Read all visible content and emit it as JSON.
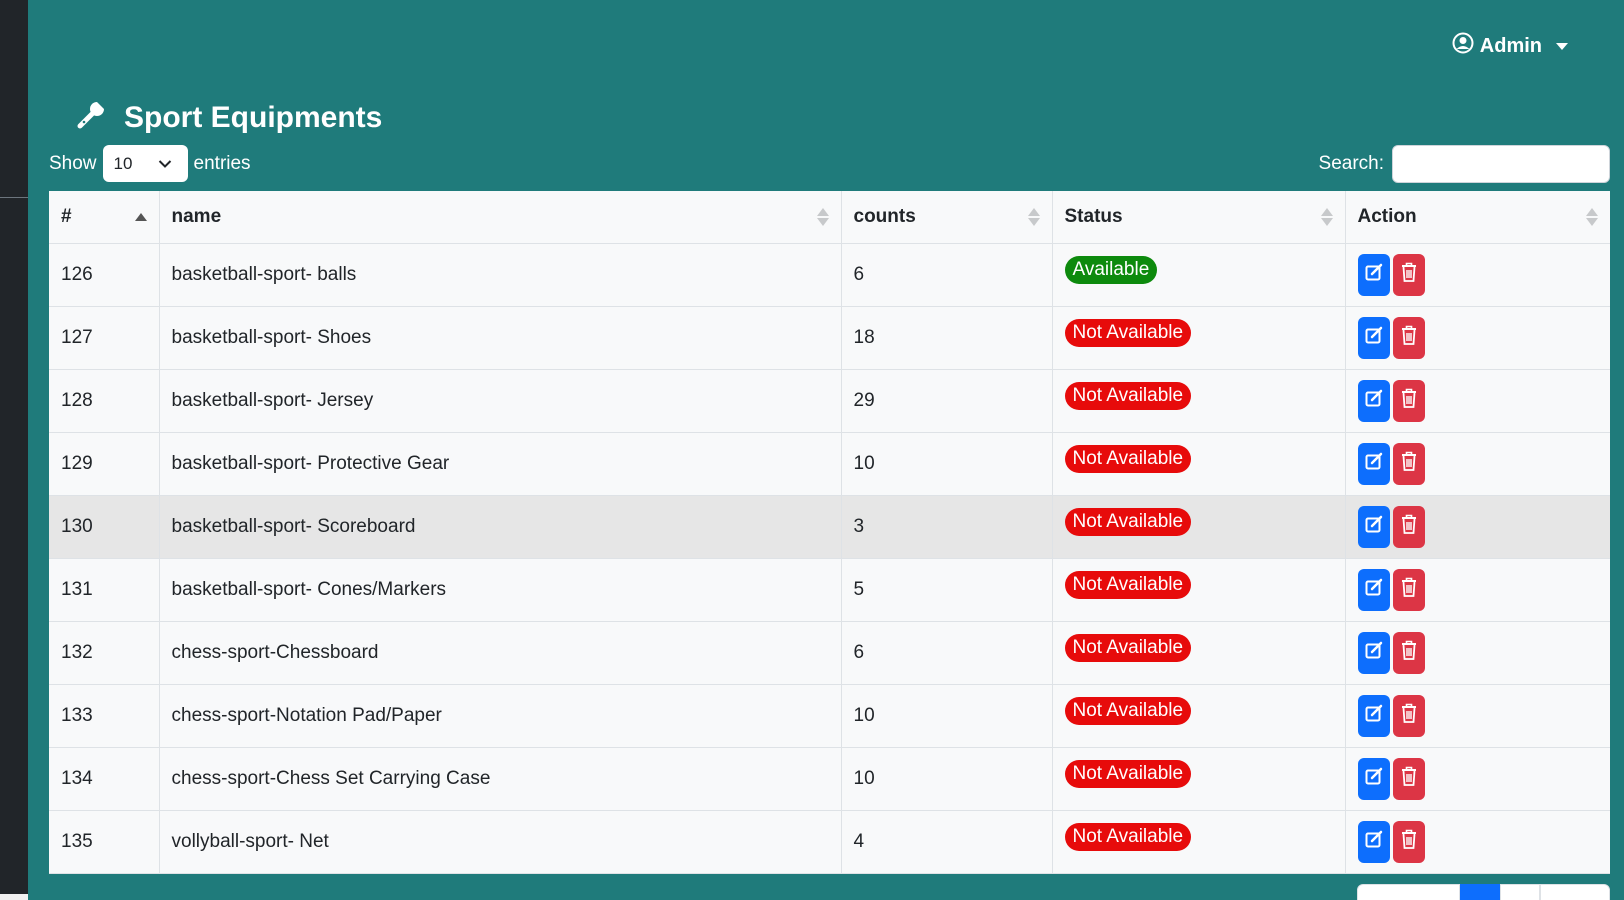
{
  "header": {
    "user_label": "Admin",
    "user_icon": "user-circle-icon"
  },
  "page": {
    "title": "Sport Equipments",
    "title_icon": "wrench-icon"
  },
  "controls": {
    "show_label": "Show",
    "entries_value": "10",
    "entries_label": "entries",
    "search_label": "Search:",
    "search_value": ""
  },
  "table": {
    "columns": [
      "#",
      "name",
      "counts",
      "Status",
      "Action"
    ],
    "rows": [
      {
        "id": "126",
        "name": "basketball-sport- balls",
        "counts": "6",
        "status": "Available"
      },
      {
        "id": "127",
        "name": "basketball-sport- Shoes",
        "counts": "18",
        "status": "Not Available"
      },
      {
        "id": "128",
        "name": "basketball-sport- Jersey",
        "counts": "29",
        "status": "Not Available"
      },
      {
        "id": "129",
        "name": "basketball-sport- Protective Gear",
        "counts": "10",
        "status": "Not Available"
      },
      {
        "id": "130",
        "name": "basketball-sport- Scoreboard",
        "counts": "3",
        "status": "Not Available"
      },
      {
        "id": "131",
        "name": "basketball-sport- Cones/Markers",
        "counts": "5",
        "status": "Not Available"
      },
      {
        "id": "132",
        "name": "chess-sport-Chessboard",
        "counts": "6",
        "status": "Not Available"
      },
      {
        "id": "133",
        "name": "chess-sport-Notation Pad/Paper",
        "counts": "10",
        "status": "Not Available"
      },
      {
        "id": "134",
        "name": "chess-sport-Chess Set Carrying Case",
        "counts": "10",
        "status": "Not Available"
      },
      {
        "id": "135",
        "name": "vollyball-sport- Net",
        "counts": "4",
        "status": "Not Available"
      }
    ]
  },
  "colors": {
    "background": "#1f7b7b",
    "available": "#0d8a0d",
    "not_available": "#e70b0b",
    "edit": "#0d6efd",
    "delete": "#dc3545"
  }
}
